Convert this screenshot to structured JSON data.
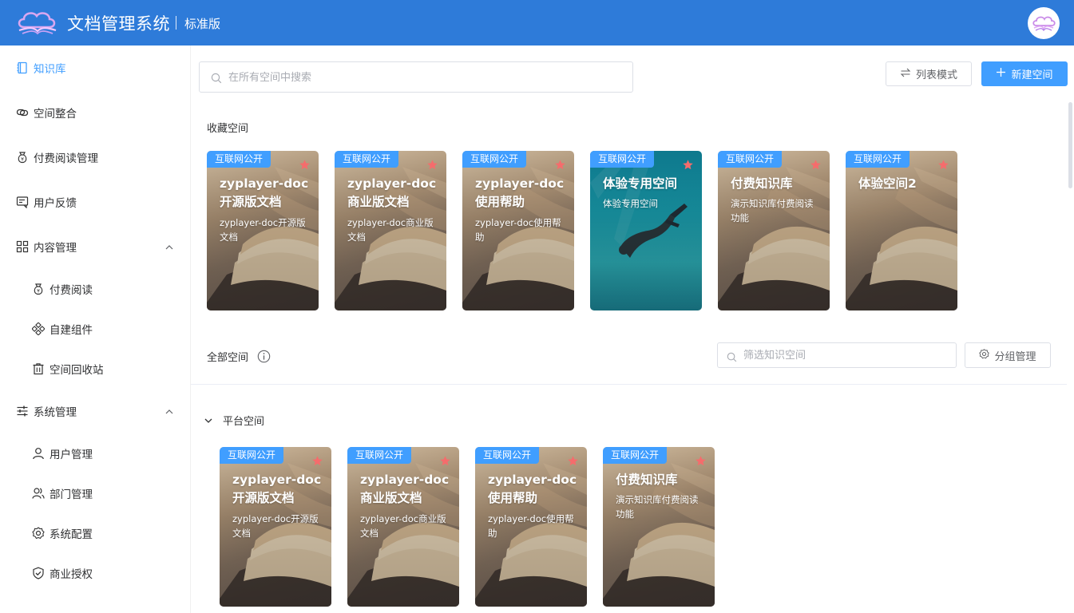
{
  "header": {
    "app_title": "文档管理系统",
    "edition": "标准版"
  },
  "sidebar": {
    "items": [
      {
        "label": "知识库",
        "icon": "notebook-icon",
        "active": true
      },
      {
        "label": "空间整合",
        "icon": "link-icon"
      },
      {
        "label": "付费阅读管理",
        "icon": "money-bag-icon"
      },
      {
        "label": "用户反馈",
        "icon": "feedback-icon"
      },
      {
        "label": "内容管理",
        "icon": "grid-icon",
        "expanded": true
      },
      {
        "label": "付费阅读",
        "icon": "money-bag-icon"
      },
      {
        "label": "自建组件",
        "icon": "components-icon"
      },
      {
        "label": "空间回收站",
        "icon": "trash-icon"
      },
      {
        "label": "系统管理",
        "icon": "sliders-icon",
        "expanded": true
      },
      {
        "label": "用户管理",
        "icon": "user-icon"
      },
      {
        "label": "部门管理",
        "icon": "users-icon"
      },
      {
        "label": "系统配置",
        "icon": "gear-icon"
      },
      {
        "label": "商业授权",
        "icon": "shield-check-icon"
      }
    ]
  },
  "toolbar": {
    "search_placeholder": "在所有空间中搜索",
    "list_mode_label": "列表模式",
    "new_space_label": "新建空间"
  },
  "favorites": {
    "title": "收藏空间",
    "cards": [
      {
        "badge": "互联网公开",
        "title": "zyplayer-doc开源版文档",
        "desc": "zyplayer-doc开源版文档"
      },
      {
        "badge": "互联网公开",
        "title": "zyplayer-doc商业版文档",
        "desc": "zyplayer-doc商业版文档"
      },
      {
        "badge": "互联网公开",
        "title": "zyplayer-doc使用帮助",
        "desc": "zyplayer-doc使用帮助"
      },
      {
        "badge": "互联网公开",
        "title": "体验专用空间",
        "desc": "体验专用空间"
      },
      {
        "badge": "互联网公开",
        "title": "付费知识库",
        "desc": "演示知识库付费阅读功能"
      },
      {
        "badge": "互联网公开",
        "title": "体验空间2",
        "desc": ""
      }
    ]
  },
  "all_spaces": {
    "title": "全部空间",
    "filter_placeholder": "筛选知识空间",
    "group_manage_label": "分组管理",
    "group_name": "平台空间",
    "cards": [
      {
        "badge": "互联网公开",
        "title": "zyplayer-doc开源版文档",
        "desc": "zyplayer-doc开源版文档"
      },
      {
        "badge": "互联网公开",
        "title": "zyplayer-doc商业版文档",
        "desc": "zyplayer-doc商业版文档"
      },
      {
        "badge": "互联网公开",
        "title": "zyplayer-doc使用帮助",
        "desc": "zyplayer-doc使用帮助"
      },
      {
        "badge": "互联网公开",
        "title": "付费知识库",
        "desc": "演示知识库付费阅读功能"
      }
    ]
  },
  "colors": {
    "header_bg": "#2e7bd9",
    "accent": "#409eff",
    "star": "#f56c6c"
  }
}
